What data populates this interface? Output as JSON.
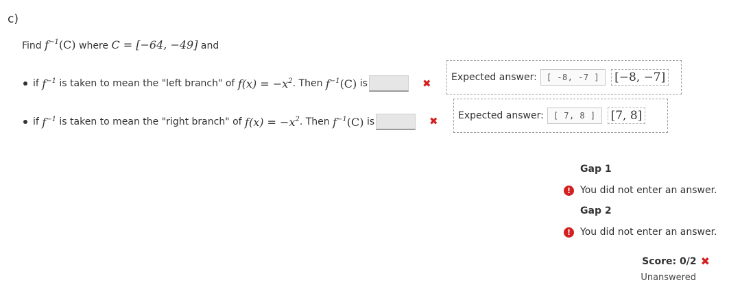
{
  "part_label": "c)",
  "prompt": {
    "find": "Find",
    "finv": "f",
    "inv_exp": "−1",
    "arg": "(C)",
    "where": "where",
    "c_def": "C = [−64, −49]",
    "and": "and"
  },
  "items": [
    {
      "if": "if",
      "finv": "f",
      "inv_exp": "−1",
      "mid": "is taken to mean the \"left branch\" of",
      "fx": "f(x) = −x",
      "sq": "2",
      "then": ". Then",
      "finv2": "f",
      "inv_exp2": "−1",
      "arg2": "(C)",
      "is": "is",
      "input_value": "",
      "expected_label": "Expected answer:",
      "expected_code": "[ -8, -7 ]",
      "expected_rendered": "[−8, −7]"
    },
    {
      "if": "if",
      "finv": "f",
      "inv_exp": "−1",
      "mid": "is taken to mean the \"right branch\" of",
      "fx": "f(x) = −x",
      "sq": "2",
      "then": ". Then",
      "finv2": "f",
      "inv_exp2": "−1",
      "arg2": "(C)",
      "is": "is",
      "input_value": "",
      "expected_label": "Expected answer:",
      "expected_code": "[ 7, 8 ]",
      "expected_rendered": "[7, 8]"
    }
  ],
  "feedback": [
    {
      "title": "Gap 1",
      "message": "You did not enter an answer."
    },
    {
      "title": "Gap 2",
      "message": "You did not enter an answer."
    }
  ],
  "icons": {
    "wrong": "cross-icon",
    "warning": "exclamation-icon"
  },
  "colors": {
    "error_red": "#d42020",
    "input_bg": "#e6e6e6"
  },
  "score": {
    "label": "Score: 0/2",
    "status": "Unanswered"
  }
}
